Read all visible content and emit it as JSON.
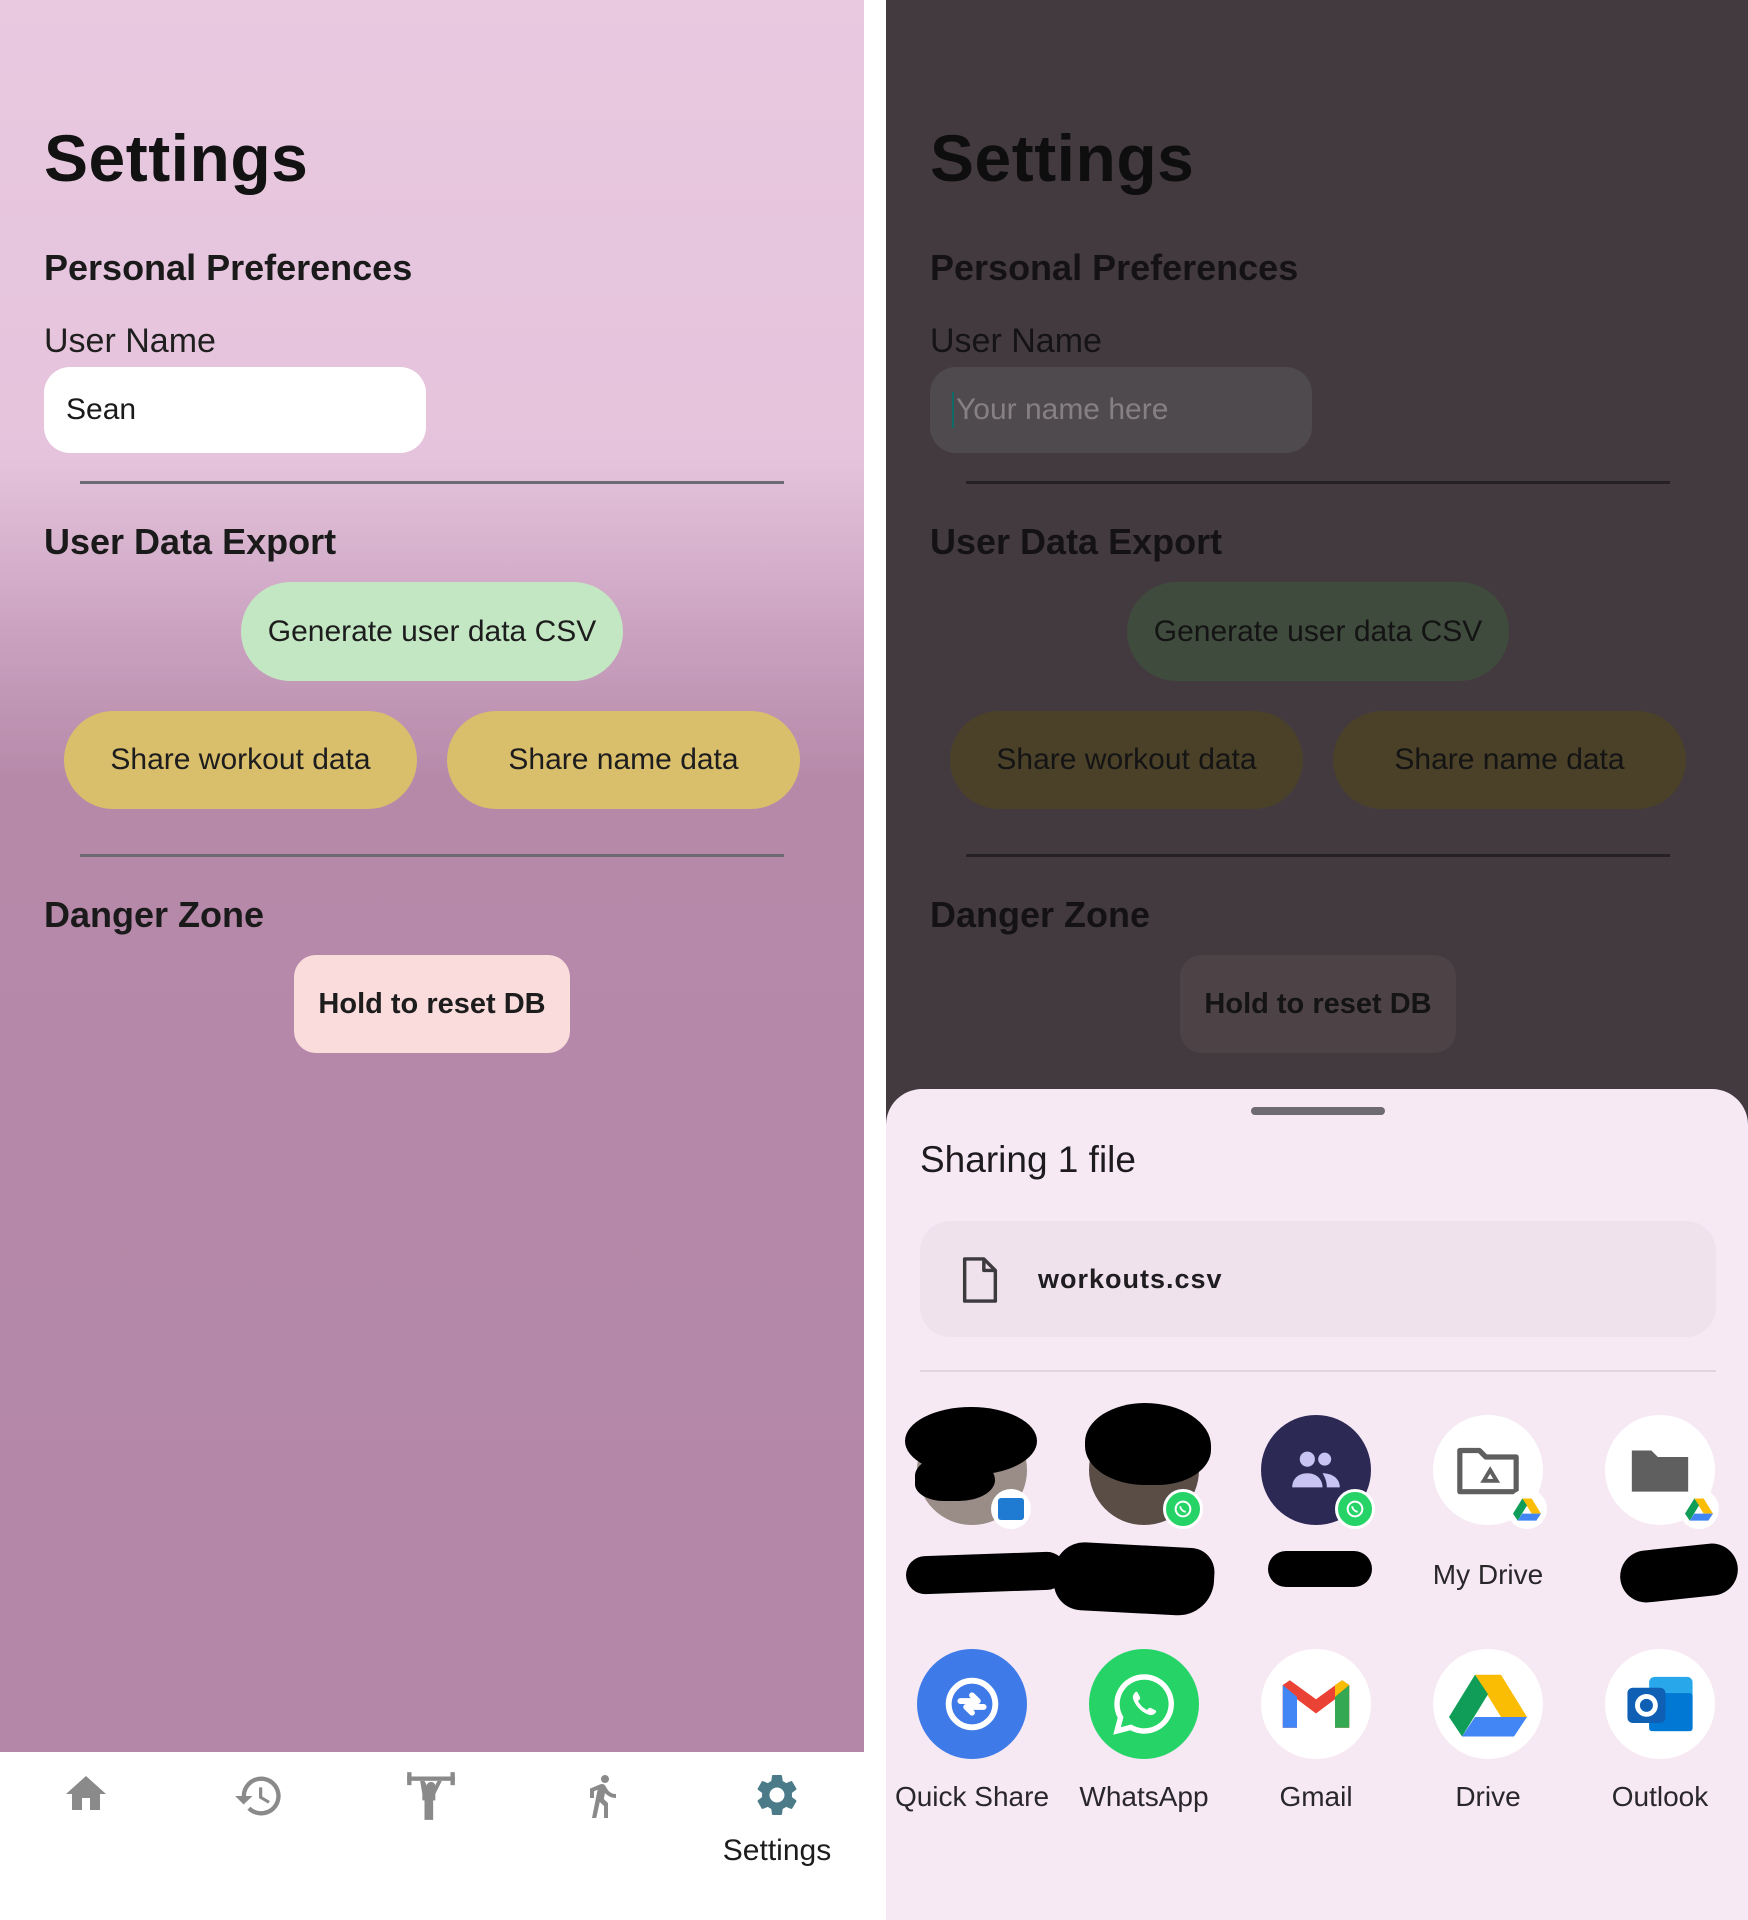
{
  "left": {
    "title": "Settings",
    "personal_preferences": "Personal Preferences",
    "user_name_label": "User Name",
    "user_name_value": "Sean",
    "user_data_export": "User Data Export",
    "generate_csv": "Generate user data CSV",
    "share_workout": "Share workout data",
    "share_name": "Share name data",
    "danger_zone": "Danger Zone",
    "reset_db": "Hold to reset DB",
    "nav": {
      "items": [
        {
          "icon": "home-icon"
        },
        {
          "icon": "history-icon"
        },
        {
          "icon": "weightlifting-icon"
        },
        {
          "icon": "running-icon"
        },
        {
          "icon": "gear-icon",
          "label": "Settings",
          "active": true
        }
      ],
      "active_color": "#4b7a88"
    }
  },
  "right": {
    "title": "Settings",
    "personal_preferences": "Personal Preferences",
    "user_name_label": "User Name",
    "user_name_placeholder": "Your name here",
    "user_data_export": "User Data Export",
    "generate_csv": "Generate user data CSV",
    "share_workout": "Share workout data",
    "share_name": "Share name data",
    "danger_zone": "Danger Zone",
    "reset_db": "Hold to reset DB",
    "share_sheet": {
      "title": "Sharing 1 file",
      "file_name": "workouts.csv",
      "direct_targets": [
        {
          "label": "",
          "badge": "outlook",
          "redacted": true
        },
        {
          "label": "",
          "badge": "whatsapp",
          "redacted": true
        },
        {
          "label": "",
          "badge": "whatsapp",
          "icon": "group-icon",
          "redacted": true
        },
        {
          "label": "My Drive",
          "badge": "drive",
          "icon": "drive-folder-icon"
        },
        {
          "label": "",
          "badge": "drive",
          "icon": "folder-icon",
          "redacted": true
        }
      ],
      "apps": [
        {
          "label": "Quick Share",
          "icon": "quick-share-icon"
        },
        {
          "label": "WhatsApp",
          "icon": "whatsapp-icon"
        },
        {
          "label": "Gmail",
          "icon": "gmail-icon"
        },
        {
          "label": "Drive",
          "icon": "drive-icon"
        },
        {
          "label": "Outlook",
          "icon": "outlook-icon"
        }
      ]
    }
  }
}
